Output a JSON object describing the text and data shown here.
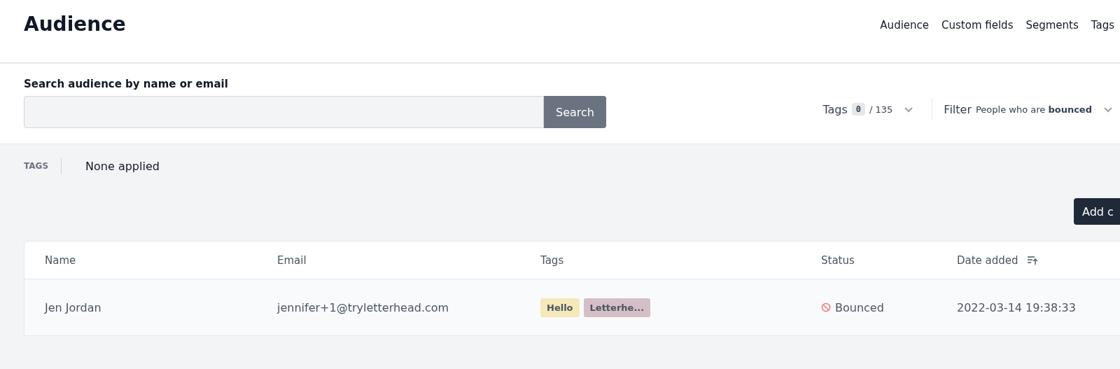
{
  "header": {
    "title": "Audience",
    "nav": [
      {
        "label": "Audience"
      },
      {
        "label": "Custom fields"
      },
      {
        "label": "Segments"
      },
      {
        "label": "Tags"
      }
    ]
  },
  "search": {
    "label": "Search audience by name or email",
    "button": "Search"
  },
  "tags_filter": {
    "label": "Tags",
    "count": "0",
    "total": "/ 135"
  },
  "filter": {
    "label": "Filter",
    "value": "People who are **bounced**"
  },
  "applied_tags": {
    "label": "TAGS",
    "value": "None applied"
  },
  "add_button": "Add c",
  "table": {
    "columns": [
      "Name",
      "Email",
      "Tags",
      "Status",
      "Date added"
    ],
    "rows": [
      {
        "name": "Jen Jordan",
        "email": "jennifer+1@tryletterhead.com",
        "tags": [
          {
            "label": "Hello",
            "color": "#f5e9b9"
          },
          {
            "label": "Letterhe...",
            "color": "#d5bfc6"
          }
        ],
        "status": {
          "kind": "bounced",
          "label": "Bounced"
        },
        "date": "2022-03-14 19:38:33"
      }
    ]
  }
}
